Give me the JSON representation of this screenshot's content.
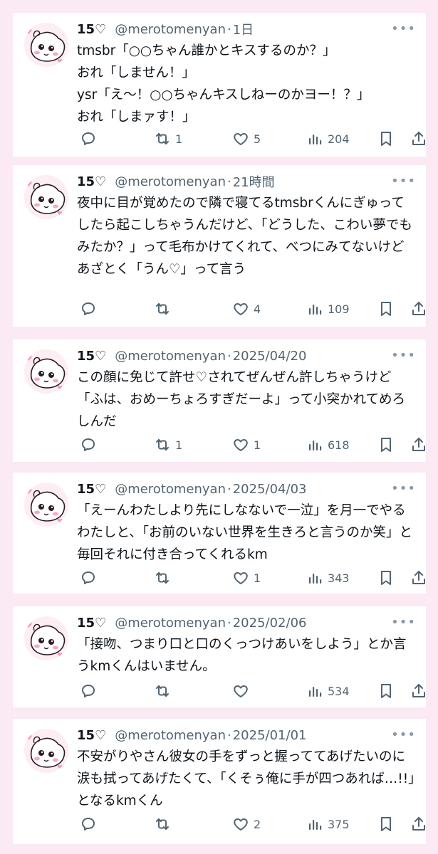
{
  "tweets": [
    {
      "name": "15♡",
      "handle": "@merotomenyan",
      "time": "1日",
      "text": "tmsbr「○○ちゃん誰かとキスするのか？」\nおれ「しません！」\nysr「え〜！○○ちゃんキスしねーのかヨー！？」\nおれ「しまァす！」",
      "replies": "",
      "retweets": "1",
      "likes": "5",
      "views": "204"
    },
    {
      "name": "15♡",
      "handle": "@merotomenyan",
      "time": "21時間",
      "text": "夜中に目が覚めたので隣で寝てるtmsbrくんにぎゅってしたら起こしちゃうんだけど、「どうした、こわい夢でもみたか？」って毛布かけてくれて、べつにみてないけどあざとく「うん♡」って言う",
      "replies": "",
      "retweets": "",
      "likes": "4",
      "views": "109"
    },
    {
      "name": "15♡",
      "handle": "@merotomenyan",
      "time": "2025/04/20",
      "text": "この顔に免じて許せ♡されてぜんぜん許しちゃうけど「ふは、おめーちょろすぎだーよ」って小突かれてめろしんだ",
      "replies": "",
      "retweets": "1",
      "likes": "1",
      "views": "618"
    },
    {
      "name": "15♡",
      "handle": "@merotomenyan",
      "time": "2025/04/03",
      "text": "「えーんわたしより先にしなないで一泣」を月一でやるわたしと、「お前のいない世界を生きろと言うのか笑」と毎回それに付き合ってくれるkm",
      "replies": "",
      "retweets": "",
      "likes": "1",
      "views": "343"
    },
    {
      "name": "15♡",
      "handle": "@merotomenyan",
      "time": "2025/02/06",
      "text": "「接吻、つまり口と口のくっつけあいをしよう」とか言うkmくんはいません。",
      "replies": "",
      "retweets": "",
      "likes": "",
      "views": "534"
    },
    {
      "name": "15♡",
      "handle": "@merotomenyan",
      "time": "2025/01/01",
      "text": "不安がりやさん彼女の手をずっと握っててあげたいのに涙も拭ってあげたくて、「くそぅ俺に手が四つあれば…!!」となるkmくん",
      "replies": "",
      "retweets": "",
      "likes": "2",
      "views": "375"
    }
  ],
  "icons": {
    "more": "more-icon",
    "reply": "reply-icon",
    "retweet": "retweet-icon",
    "like": "heart-icon",
    "views": "views-icon",
    "bookmark": "bookmark-icon",
    "share": "share-icon"
  },
  "colors": {
    "background": "#fbe9f3",
    "card": "#ffffff",
    "text": "#0f1419",
    "muted": "#536471"
  }
}
